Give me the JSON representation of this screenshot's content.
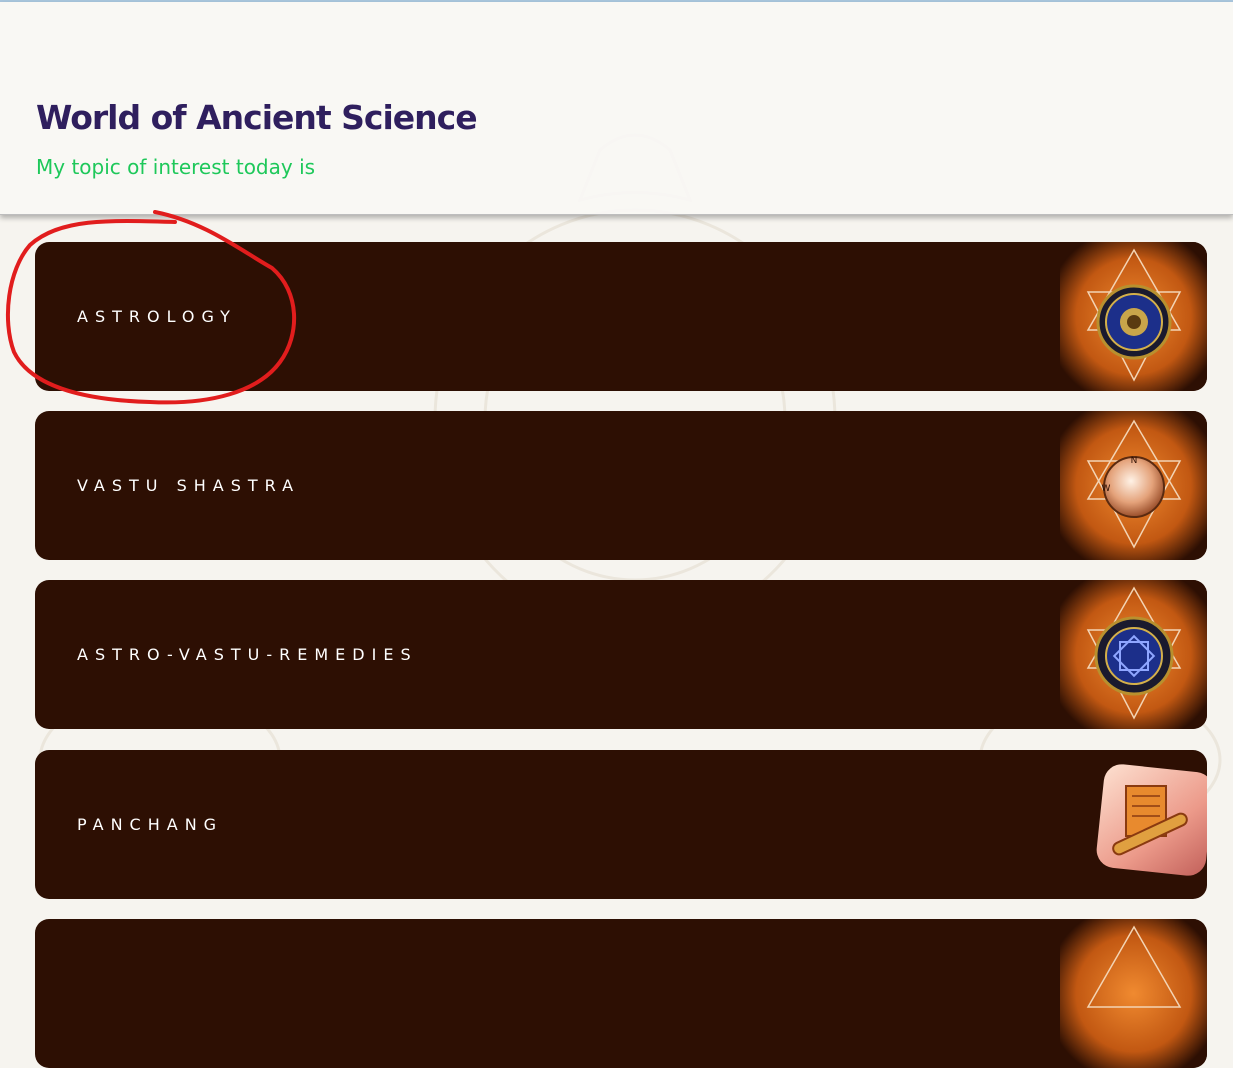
{
  "header": {
    "title": "World of Ancient Science",
    "subtitle": "My topic of interest today is"
  },
  "topics": [
    {
      "label": "ASTROLOGY",
      "icon": "zodiac-wheel-icon"
    },
    {
      "label": "VASTU SHASTRA",
      "icon": "vastu-compass-icon"
    },
    {
      "label": "ASTRO-VASTU-REMEDIES",
      "icon": "zodiac-yantra-icon"
    },
    {
      "label": "PANCHANG",
      "icon": "scroll-icon"
    },
    {
      "label": "",
      "icon": "triangle-icon"
    }
  ],
  "colors": {
    "title": "#2f1f5e",
    "subtitle": "#1ec85a",
    "card_bg": "#2d0f03",
    "icon_glow": "#e8761e",
    "annotation": "#e11d1d"
  }
}
